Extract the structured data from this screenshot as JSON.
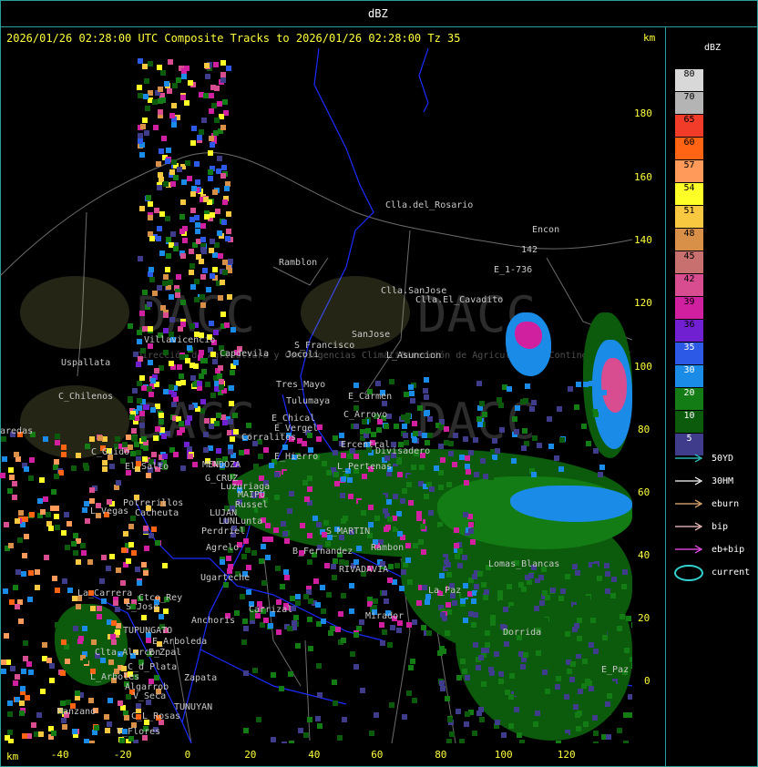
{
  "window_title": "dBZ",
  "header": "2026/01/26 02:28:00 UTC Composite Tracks to 2026/01/26 02:28:00 Tz 35",
  "units": {
    "top_right": "km",
    "bottom_left": "km"
  },
  "y_ticks": [
    "180",
    "160",
    "140",
    "120",
    "100",
    "80",
    "60",
    "40",
    "20",
    "0"
  ],
  "x_ticks": [
    "-40",
    "-20",
    "0",
    "20",
    "40",
    "60",
    "80",
    "100",
    "120"
  ],
  "legend": {
    "title": "dBZ",
    "scale": [
      {
        "label": "80",
        "color": "#d8d8d8"
      },
      {
        "label": "70",
        "color": "#b4b4b4"
      },
      {
        "label": "65",
        "color": "#f03c28"
      },
      {
        "label": "60",
        "color": "#ff6414"
      },
      {
        "label": "57",
        "color": "#ff9a5a"
      },
      {
        "label": "54",
        "color": "#ffff28"
      },
      {
        "label": "51",
        "color": "#f8c840"
      },
      {
        "label": "48",
        "color": "#d89048"
      },
      {
        "label": "45",
        "color": "#c87070"
      },
      {
        "label": "42",
        "color": "#d84c90"
      },
      {
        "label": "39",
        "color": "#d020a0"
      },
      {
        "label": "36",
        "color": "#7020d0"
      },
      {
        "label": "35",
        "color": "#2c5ae6"
      },
      {
        "label": "30",
        "color": "#1a8ce8"
      },
      {
        "label": "20",
        "color": "#147c14"
      },
      {
        "label": "10",
        "color": "#0c5a0c"
      },
      {
        "label": "5",
        "color": "#403c8c"
      }
    ],
    "tracks": [
      {
        "label": "50YD",
        "color": "#32d2d2"
      },
      {
        "label": "30HM",
        "color": "#ffffff"
      },
      {
        "label": "eburn",
        "color": "#f0b478"
      },
      {
        "label": "bip",
        "color": "#ffc8c8"
      },
      {
        "label": "eb+bip",
        "color": "#ff50ff"
      },
      {
        "label": "current",
        "color": "#32d2d2"
      }
    ]
  },
  "watermark": {
    "text": "DACC",
    "subtext": "Dirección de Agricultura y Contingencias Climáticas"
  },
  "places": [
    {
      "name": "Clla.del_Rosario"
    },
    {
      "name": "Encon"
    },
    {
      "name": "142"
    },
    {
      "name": "E_1-736"
    },
    {
      "name": "Ramblon"
    },
    {
      "name": "Clla.SanJose"
    },
    {
      "name": "Clla.El_Cavadito"
    },
    {
      "name": "Villavicencio"
    },
    {
      "name": "Capdevila"
    },
    {
      "name": "S_Francisco"
    },
    {
      "name": "Jocoli"
    },
    {
      "name": "SanJose"
    },
    {
      "name": "L_Asuncion"
    },
    {
      "name": "Uspallata"
    },
    {
      "name": "Tres_Mayo"
    },
    {
      "name": "Tulumaya"
    },
    {
      "name": "E_Carmen"
    },
    {
      "name": "C_Chilenos"
    },
    {
      "name": "E_Chical"
    },
    {
      "name": "E_Vergel"
    },
    {
      "name": "C_Arroyo"
    },
    {
      "name": "aredas"
    },
    {
      "name": "Corralitos"
    },
    {
      "name": "Ercentral"
    },
    {
      "name": "Divisadero"
    },
    {
      "name": "C_Guido"
    },
    {
      "name": "El_Salto"
    },
    {
      "name": "MENDOZA"
    },
    {
      "name": "G_CRUZ"
    },
    {
      "name": "E_Hierro"
    },
    {
      "name": "L_Pertenas"
    },
    {
      "name": "Luzuriaga"
    },
    {
      "name": "MAIPU"
    },
    {
      "name": "Russel"
    },
    {
      "name": "Potrerillos"
    },
    {
      "name": "Cacheuta"
    },
    {
      "name": "L_Vegas"
    },
    {
      "name": "LUJAN"
    },
    {
      "name": "LUNLunta"
    },
    {
      "name": "Perdriel"
    },
    {
      "name": "S_MARTIN"
    },
    {
      "name": "Rambon"
    },
    {
      "name": "Agrelo"
    },
    {
      "name": "B_Fernandez"
    },
    {
      "name": "Ugarteche"
    },
    {
      "name": "Lomas_Blancas"
    },
    {
      "name": "La_Carrera"
    },
    {
      "name": "Ctco_Rey"
    },
    {
      "name": "S_Jose"
    },
    {
      "name": "Carrizal"
    },
    {
      "name": "RIVADAVIA"
    },
    {
      "name": "La_Paz"
    },
    {
      "name": "Anchoris"
    },
    {
      "name": "TUPUNGATO"
    },
    {
      "name": "Mirador"
    },
    {
      "name": "Dorrida"
    },
    {
      "name": "E_Arboleda"
    },
    {
      "name": "E_Zpal"
    },
    {
      "name": "Clta.Alarcon"
    },
    {
      "name": "C_d_Plata"
    },
    {
      "name": "Zapata"
    },
    {
      "name": "L_Arboles"
    },
    {
      "name": "Algarrob"
    },
    {
      "name": "V_Seca"
    },
    {
      "name": "TUNUYAN"
    },
    {
      "name": "Manzano"
    },
    {
      "name": "C_L_Rosas"
    },
    {
      "name": "V_Flores"
    },
    {
      "name": "E_Paz"
    }
  ]
}
